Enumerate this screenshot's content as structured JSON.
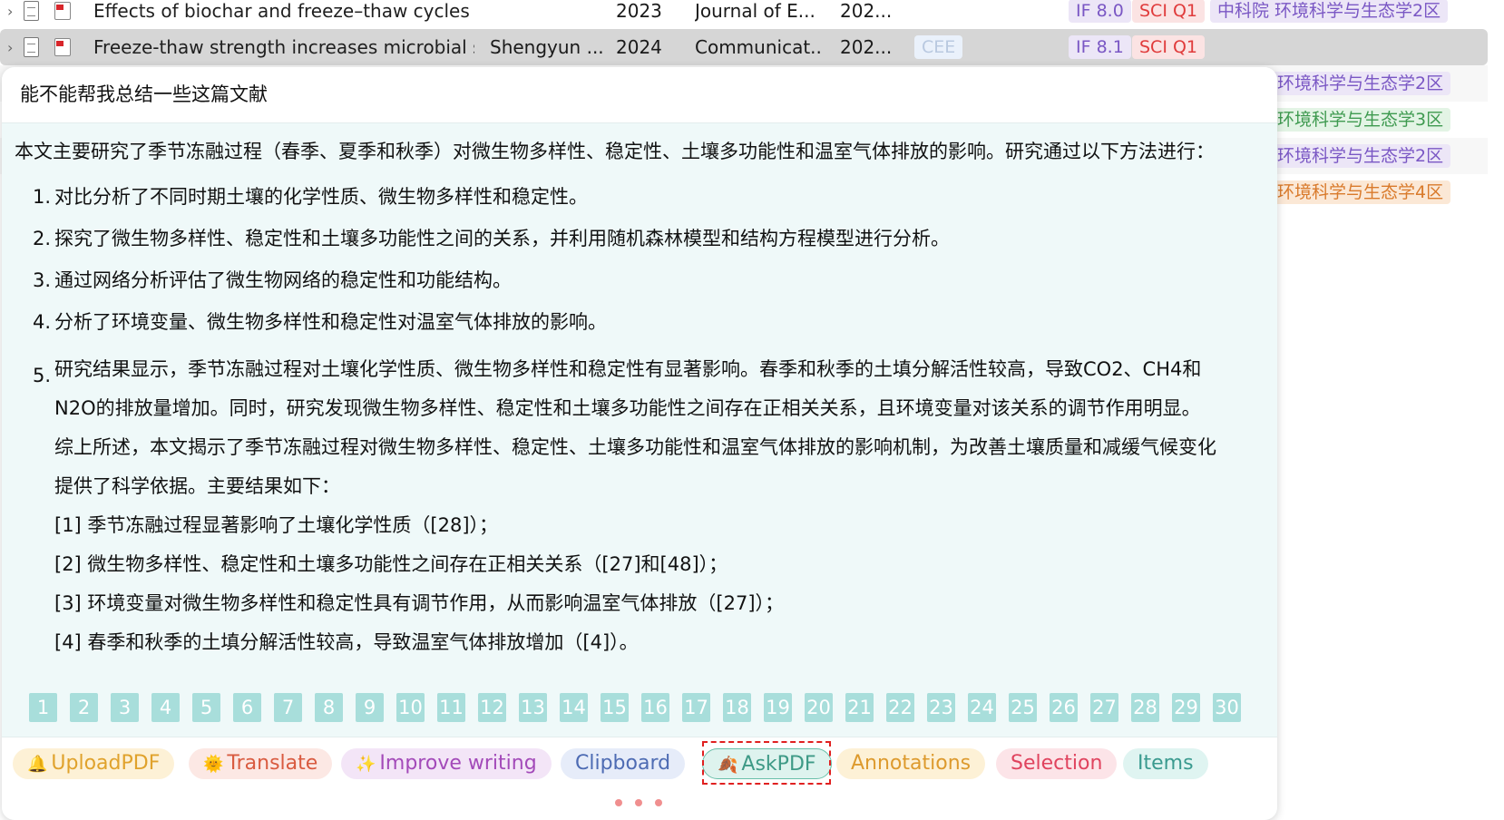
{
  "table": {
    "rows": [
      {
        "title": "Effects of biochar and freeze–thaw cycles on",
        "creator": "",
        "year": "2023",
        "publication": "Journal of E...",
        "date": "202...",
        "tag_if": "IF 8.0",
        "tag_sci": "SCI Q1",
        "tag_cas": "中科院 环境科学与生态学2区"
      },
      {
        "title": "Freeze-thaw strength increases microbial sta",
        "creator": "Shengyun ...",
        "year": "2024",
        "publication": "Communicat...",
        "date": "202...",
        "tag_cee": "CEE",
        "tag_if": "IF 8.1",
        "tag_sci": "SCI Q1"
      }
    ],
    "side_tags": [
      {
        "text": "环境科学与生态学2区",
        "color": "purple"
      },
      {
        "text": "环境科学与生态学3区",
        "color": "green"
      },
      {
        "text": "环境科学与生态学2区",
        "color": "purple"
      },
      {
        "text": "环境科学与生态学4区",
        "color": "orange"
      }
    ]
  },
  "popup": {
    "prompt": "能不能帮我总结一些这篇文献",
    "intro": "本文主要研究了季节冻融过程（春季、夏季和秋季）对微生物多样性、稳定性、土壤多功能性和温室气体排放的影响。研究通过以下方法进行：",
    "items": [
      {
        "num": "1.",
        "text": "对比分析了不同时期土壤的化学性质、微生物多样性和稳定性。"
      },
      {
        "num": "2.",
        "text": "探究了微生物多样性、稳定性和土壤多功能性之间的关系，并利用随机森林模型和结构方程模型进行分析。"
      },
      {
        "num": "3.",
        "text": "通过网络分析评估了微生物网络的稳定性和功能结构。"
      },
      {
        "num": "4.",
        "text": "分析了环境变量、微生物多样性和稳定性对温室气体排放的影响。"
      }
    ],
    "item5": {
      "num": "5.",
      "lines": [
        "研究结果显示，季节冻融过程对土壤化学性质、微生物多样性和稳定性有显著影响。春季和秋季的土填分解活性较高，导致CO2、CH4和",
        "N2O的排放量增加。同时，研究发现微生物多样性、稳定性和土壤多功能性之间存在正相关关系，且环境变量对该关系的调节作用明显。",
        "综上所述，本文揭示了季节冻融过程对微生物多样性、稳定性、土壤多功能性和温室气体排放的影响机制，为改善土壤质量和减缓气候变化",
        "提供了科学依据。主要结果如下：",
        "[1] 季节冻融过程显著影响了土壤化学性质（[28]）；",
        "[2] 微生物多样性、稳定性和土壤多功能性之间存在正相关关系（[27]和[48]）；",
        "[3] 环境变量对微生物多样性和稳定性具有调节作用，从而影响温室气体排放（[27]）；",
        "[4] 春季和秋季的土填分解活性较高，导致温室气体排放增加（[4]）。"
      ]
    },
    "pages": [
      "1",
      "2",
      "3",
      "4",
      "5",
      "6",
      "7",
      "8",
      "9",
      "10",
      "11",
      "12",
      "13",
      "14",
      "15",
      "16",
      "17",
      "18",
      "19",
      "20",
      "21",
      "22",
      "23",
      "24",
      "25",
      "26",
      "27",
      "28",
      "29",
      "30"
    ],
    "toolbar": {
      "upload": "UploadPDF",
      "translate": "Translate",
      "improve": "Improve writing",
      "clipboard": "Clipboard",
      "askpdf": "AskPDF",
      "annotations": "Annotations",
      "selection": "Selection",
      "items": "Items"
    }
  }
}
